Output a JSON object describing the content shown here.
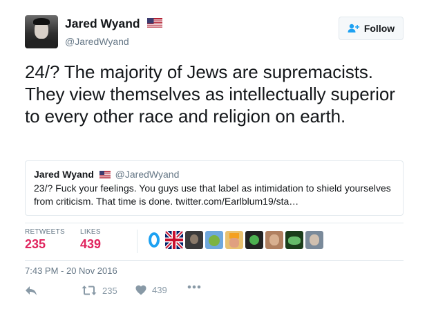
{
  "author": {
    "name": "Jared Wyand",
    "handle": "@JaredWyand",
    "flag": "us-flag-icon"
  },
  "follow_button": {
    "label": "Follow",
    "icon": "add-user-icon"
  },
  "tweet": {
    "text": "24/? The majority of Jews are supremacists. They view themselves as intellectually superior to every other race and religion on earth."
  },
  "quoted_tweet": {
    "name": "Jared Wyand",
    "handle": "@JaredWyand",
    "text": "23/? Fuck your feelings. You guys use that label as intimidation to shield yourselves from criticism. That time is done. twitter.com/Earlblum19/sta…"
  },
  "stats": {
    "retweets_label": "RETWEETS",
    "retweets_value": "235",
    "likes_label": "LIKES",
    "likes_value": "439"
  },
  "likers": [
    "avatar-blue-egg",
    "avatar-uk-flag",
    "avatar-3",
    "avatar-4",
    "avatar-5",
    "avatar-6",
    "avatar-7",
    "avatar-8",
    "avatar-9"
  ],
  "timestamp": "7:43 PM - 20 Nov 2016",
  "actions": {
    "reply_icon": "reply-icon",
    "retweet_icon": "retweet-icon",
    "retweet_count": "235",
    "like_icon": "heart-icon",
    "like_count": "439",
    "more_icon": "more-icon"
  },
  "colors": {
    "accent": "#1da1f2",
    "stat_value": "#e0245e",
    "muted": "#657786",
    "border": "#e1e8ed"
  }
}
